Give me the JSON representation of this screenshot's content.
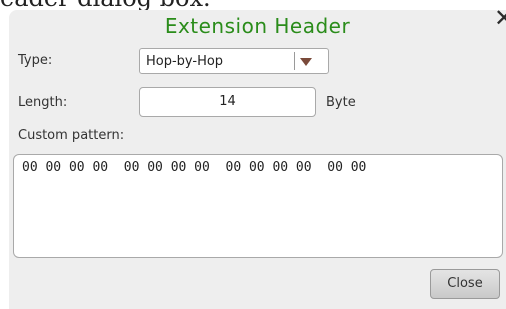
{
  "caption_fragment": "eader dialog box.",
  "dialog": {
    "title": "Extension Header",
    "close_icon": "close-x-icon"
  },
  "type_field": {
    "label": "Type:",
    "value": "Hop-by-Hop",
    "arrow_icon": "dropdown-arrow-icon"
  },
  "length_field": {
    "label": "Length:",
    "value": "14",
    "unit": "Byte"
  },
  "custom_pattern": {
    "label": "Custom pattern:",
    "value": "00 00 00 00  00 00 00 00  00 00 00 00  00 00"
  },
  "buttons": {
    "close_label": "Close"
  },
  "colors": {
    "title": "#2a8c1a",
    "dialog_background": "#eeeeee",
    "dropdown_arrow": "#7a4a3a"
  }
}
